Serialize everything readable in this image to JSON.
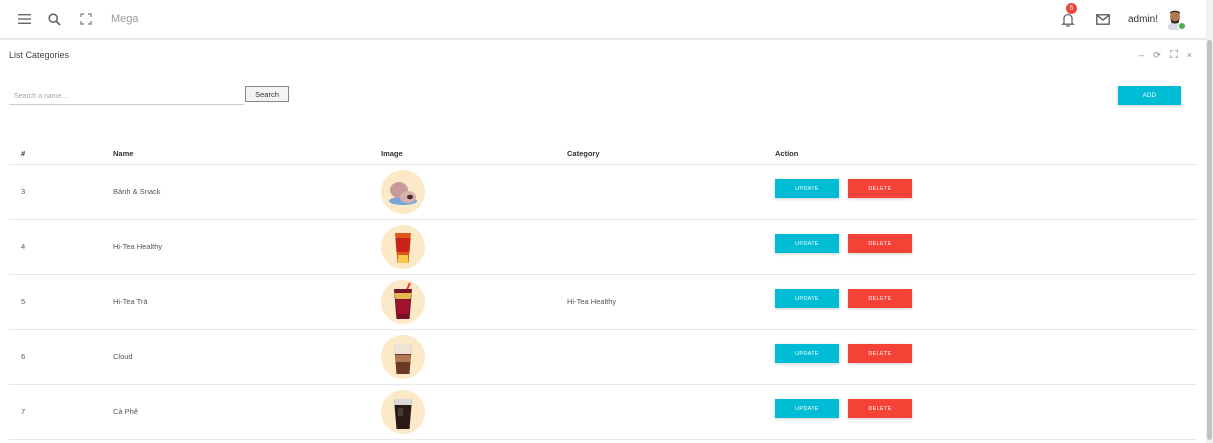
{
  "navbar": {
    "brand": "Mega",
    "username": "admin!",
    "notification_count": "5"
  },
  "card": {
    "title": "List Categories",
    "search_placeholder": "Search a name...",
    "search_label": "Search",
    "add_label": "ADD"
  },
  "table": {
    "headers": {
      "id": "#",
      "name": "Name",
      "image": "Image",
      "category": "Category",
      "action": "Action"
    },
    "rows": [
      {
        "id": "3",
        "name": "Bánh & Snack",
        "category": "",
        "update": "UPDATE",
        "delete": "DELETE"
      },
      {
        "id": "4",
        "name": "Hi-Tea Healthy",
        "category": "",
        "update": "UPDATE",
        "delete": "DELETE"
      },
      {
        "id": "5",
        "name": "Hi-Tea Trà",
        "category": "Hi-Tea Healthy",
        "update": "UPDATE",
        "delete": "DELETE"
      },
      {
        "id": "6",
        "name": "Cloud",
        "category": "",
        "update": "UPDATE",
        "delete": "DELETE"
      },
      {
        "id": "7",
        "name": "Cà Phê",
        "category": "",
        "update": "UPDATE",
        "delete": "DELETE"
      }
    ]
  },
  "colors": {
    "accent": "#00bcd4",
    "danger": "#f44336"
  }
}
